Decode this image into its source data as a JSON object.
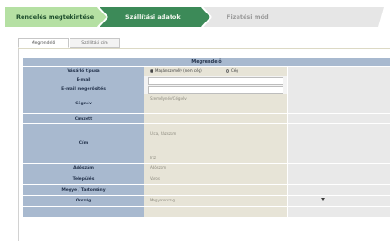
{
  "steps": [
    {
      "label": "Rendelés megtekintése",
      "state": "done"
    },
    {
      "label": "Szállítási adatok",
      "state": "active"
    },
    {
      "label": "Fizetési mód",
      "state": "pending"
    }
  ],
  "tabs": [
    {
      "label": "Megrendelő",
      "active": true
    },
    {
      "label": "Szállítási cím",
      "active": false
    }
  ],
  "form": {
    "title": "Megrendelő",
    "rows": {
      "type": {
        "label": "Vásárló típusa",
        "option_private": "Magánszemély (nem cég)",
        "option_company": "Cég"
      },
      "email": {
        "label": "E-mail"
      },
      "email_confirm": {
        "label": "E-mail megerősítés"
      },
      "name": {
        "label": "Cégnév",
        "value": "Személynév/Cégnév"
      },
      "contact": {
        "label": "Címzett"
      },
      "address": {
        "label": "Cím",
        "line1": "Utca, házszám",
        "line2": "Irsz"
      },
      "tax": {
        "label": "Adószám",
        "value": "Adószám"
      },
      "city": {
        "label": "Település",
        "value": "Város"
      },
      "county": {
        "label": "Megye / Tartomány"
      },
      "country": {
        "label": "Ország",
        "value": "Magyarország"
      }
    }
  },
  "colors": {
    "step_done": "#b5e0a3",
    "step_active": "#3c8a58",
    "step_pending": "#e6e6e6",
    "label_bg": "#a8b9cf",
    "value_bg": "#e7e4d7"
  }
}
